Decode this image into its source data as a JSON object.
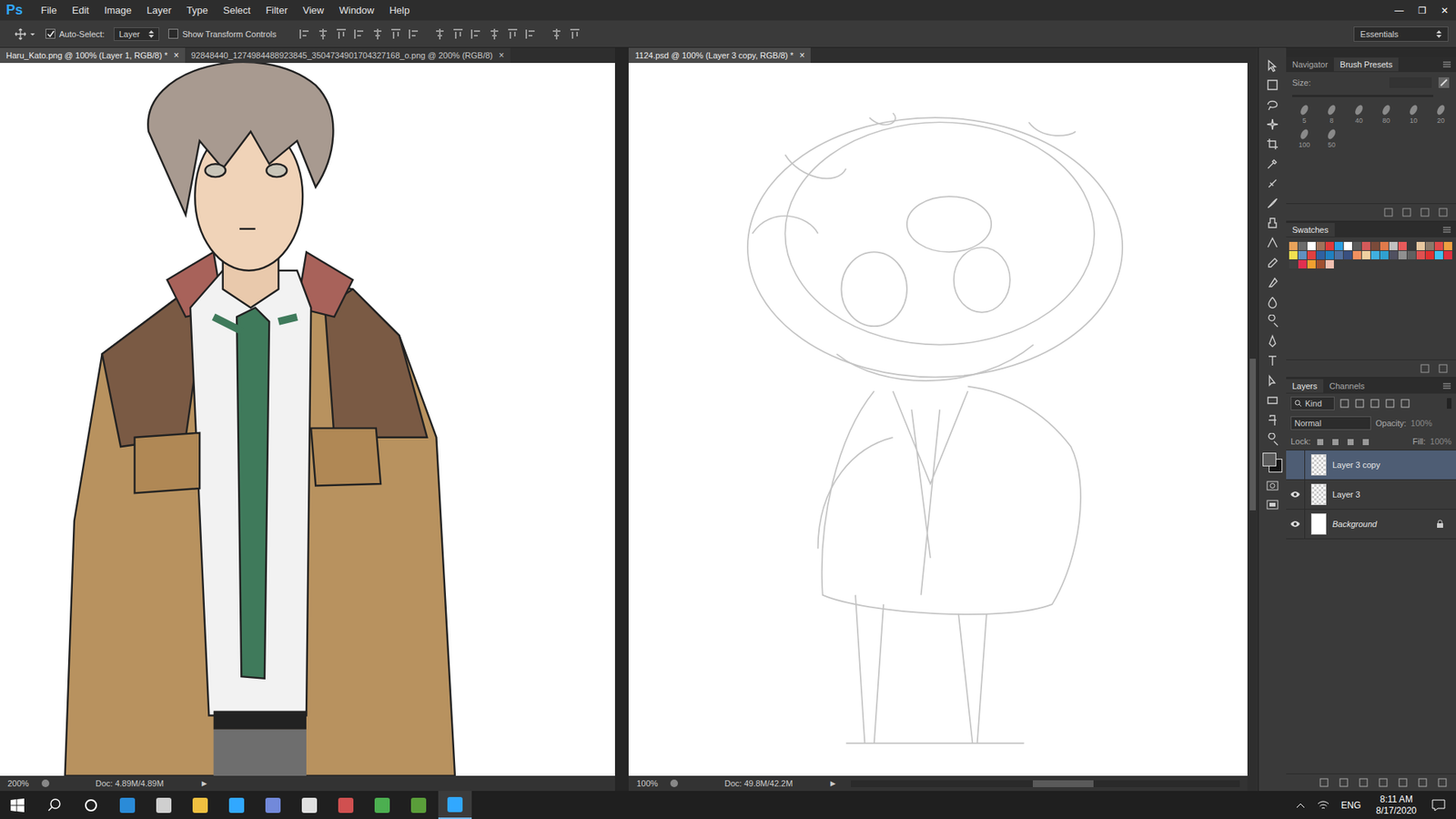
{
  "app": {
    "logo": "Ps",
    "menu": [
      "File",
      "Edit",
      "Image",
      "Layer",
      "Type",
      "Select",
      "Filter",
      "View",
      "Window",
      "Help"
    ],
    "window_controls": [
      "—",
      "❐",
      "✕"
    ]
  },
  "options_bar": {
    "auto_select": {
      "label": "Auto-Select:",
      "checked": true
    },
    "target": "Layer",
    "show_transform": {
      "label": "Show Transform Controls",
      "checked": false
    },
    "workspace": "Essentials"
  },
  "documents": [
    {
      "tabs": [
        {
          "label": "Haru_Kato.png @ 100% (Layer 1, RGB/8) *",
          "close": "×",
          "selected": true
        },
        {
          "label": "92848440_1274984488923845_3504734901704327168_o.png @ 200% (RGB/8)",
          "close": "×",
          "selected": false
        }
      ],
      "zoom": "200%",
      "doc_size": "Doc: 4.89M/4.89M",
      "arrow": "▶",
      "artwork": "character"
    },
    {
      "tabs": [
        {
          "label": "1124.psd @ 100% (Layer 3 copy, RGB/8) *",
          "close": "×",
          "selected": true
        }
      ],
      "zoom": "100%",
      "doc_size": "Doc: 49.8M/42.2M",
      "arrow": "▶",
      "artwork": "sketch"
    }
  ],
  "brush_panel": {
    "tabs": [
      {
        "label": "Navigator",
        "selected": false
      },
      {
        "label": "Brush Presets",
        "selected": true
      }
    ],
    "size_label": "Size:",
    "brushes": [
      "5",
      "8",
      "40",
      "80",
      "10",
      "20",
      "100",
      "50"
    ]
  },
  "swatches": {
    "title": "Swatches",
    "colors": [
      "#e8a25a",
      "#6b6b6b",
      "#ffffff",
      "#a0725a",
      "#e03a3a",
      "#2c9ee0",
      "#ffffff",
      "#5a5a5a",
      "#d45a5a",
      "#7a4a3a",
      "#e07a4a",
      "#c0c0c0",
      "#e85a5a",
      "#3a3a3a",
      "#e8c8a0",
      "#8a7a6a",
      "#e04a4a",
      "#f0a040",
      "#f0e050",
      "#6090c0",
      "#e04040",
      "#3060a0",
      "#2080c0",
      "#5070a0",
      "#3a5080",
      "#f09060",
      "#f0d0a0",
      "#40b0e0",
      "#30a0d0",
      "#505060",
      "#909090",
      "#606060",
      "#e05050",
      "#e03030",
      "#40c0f0",
      "#e03040",
      "#404040",
      "#e03050",
      "#f0a030",
      "#a05030",
      "#f0c0b0"
    ]
  },
  "layers_panel": {
    "tabs": [
      {
        "label": "Layers",
        "selected": true
      },
      {
        "label": "Channels",
        "selected": false
      }
    ],
    "filter": "Kind",
    "blend_mode": "Normal",
    "opacity_label": "Opacity:",
    "opacity": "100%",
    "lock_label": "Lock:",
    "fill_label": "Fill:",
    "fill": "100%",
    "layers": [
      {
        "name": "Layer 3 copy",
        "visible": false,
        "selected": true,
        "locked": false
      },
      {
        "name": "Layer 3",
        "visible": true,
        "selected": false,
        "locked": false
      },
      {
        "name": "Background",
        "visible": true,
        "selected": false,
        "locked": true
      }
    ]
  },
  "taskbar": {
    "language": "ENG",
    "time": "8:11 AM",
    "date": "8/17/2020"
  }
}
